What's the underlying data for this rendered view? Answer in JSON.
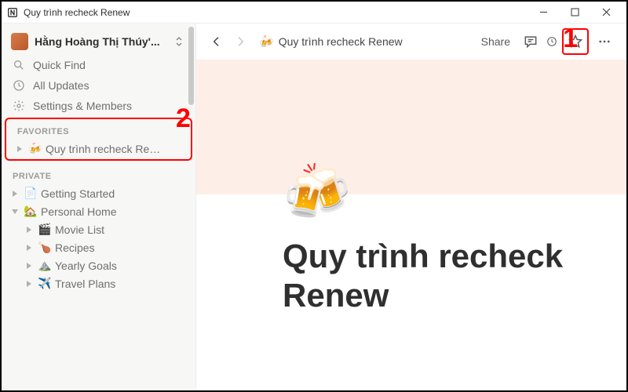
{
  "window": {
    "title": "Quy trình recheck Renew"
  },
  "workspace": {
    "name": "Hằng Hoàng Thị Thúy'..."
  },
  "sidebar": {
    "quick_find": "Quick Find",
    "all_updates": "All Updates",
    "settings": "Settings & Members",
    "sections": {
      "favorites": "FAVORITES",
      "private": "PRIVATE"
    },
    "favorites": [
      {
        "emoji": "🍻",
        "label": "Quy trình recheck Re…"
      }
    ],
    "private": [
      {
        "emoji": "📄",
        "label": "Getting Started",
        "open": false,
        "nested": false
      },
      {
        "emoji": "🏡",
        "label": "Personal Home",
        "open": true,
        "nested": false
      },
      {
        "emoji": "🎬",
        "label": "Movie List",
        "open": false,
        "nested": true
      },
      {
        "emoji": "🍗",
        "label": "Recipes",
        "open": false,
        "nested": true
      },
      {
        "emoji": "⛰️",
        "label": "Yearly Goals",
        "open": false,
        "nested": true
      },
      {
        "emoji": "✈️",
        "label": "Travel Plans",
        "open": false,
        "nested": true
      }
    ]
  },
  "topbar": {
    "crumb_emoji": "🍻",
    "crumb_text": "Quy trình recheck Renew",
    "share": "Share"
  },
  "page": {
    "icon": "🍻",
    "title": "Quy trình recheck Renew"
  },
  "annotations": {
    "one": "1",
    "two": "2"
  }
}
